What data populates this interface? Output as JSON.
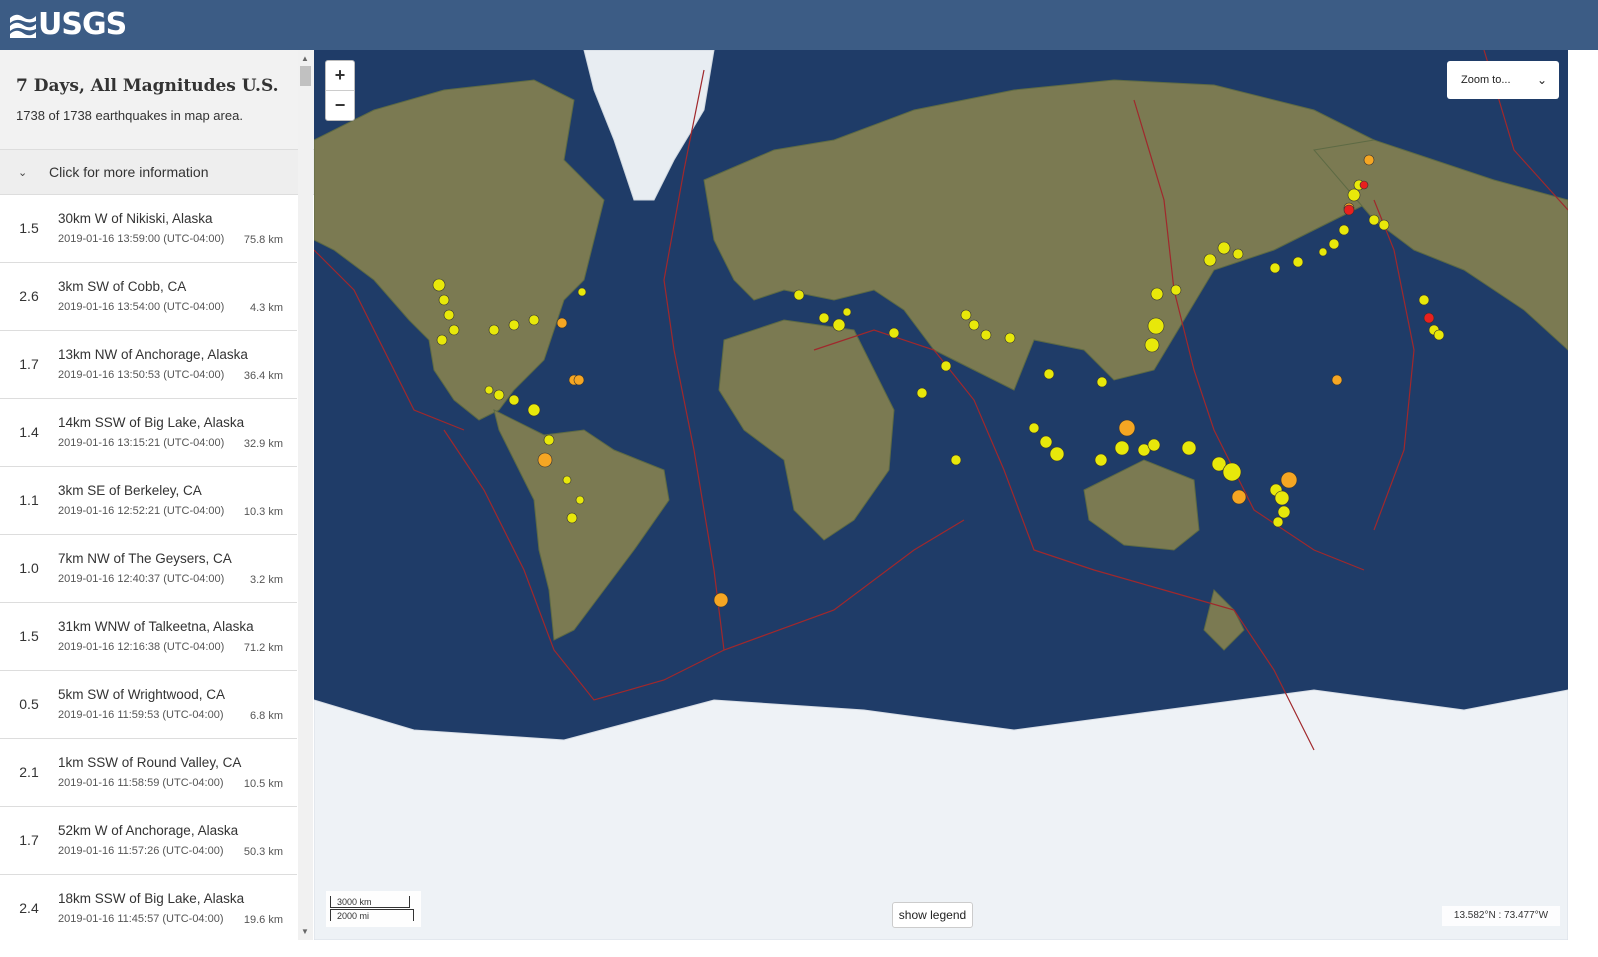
{
  "header": {
    "logo_text": "USGS"
  },
  "sidebar": {
    "title": "7 Days, All Magnitudes U.S.",
    "count": "1738 of 1738 earthquakes in map area.",
    "more_info": "Click for more information",
    "earthquakes": [
      {
        "mag": "1.5",
        "place": "30km W of Nikiski, Alaska",
        "time": "2019-01-16 13:59:00 (UTC-04:00)",
        "depth": "75.8 km"
      },
      {
        "mag": "2.6",
        "place": "3km SW of Cobb, CA",
        "time": "2019-01-16 13:54:00 (UTC-04:00)",
        "depth": "4.3 km"
      },
      {
        "mag": "1.7",
        "place": "13km NW of Anchorage, Alaska",
        "time": "2019-01-16 13:50:53 (UTC-04:00)",
        "depth": "36.4 km"
      },
      {
        "mag": "1.4",
        "place": "14km SSW of Big Lake, Alaska",
        "time": "2019-01-16 13:15:21 (UTC-04:00)",
        "depth": "32.9 km"
      },
      {
        "mag": "1.1",
        "place": "3km SE of Berkeley, CA",
        "time": "2019-01-16 12:52:21 (UTC-04:00)",
        "depth": "10.3 km"
      },
      {
        "mag": "1.0",
        "place": "7km NW of The Geysers, CA",
        "time": "2019-01-16 12:40:37 (UTC-04:00)",
        "depth": "3.2 km"
      },
      {
        "mag": "1.5",
        "place": "31km WNW of Talkeetna, Alaska",
        "time": "2019-01-16 12:16:38 (UTC-04:00)",
        "depth": "71.2 km"
      },
      {
        "mag": "0.5",
        "place": "5km SW of Wrightwood, CA",
        "time": "2019-01-16 11:59:53 (UTC-04:00)",
        "depth": "6.8 km"
      },
      {
        "mag": "2.1",
        "place": "1km SSW of Round Valley, CA",
        "time": "2019-01-16 11:58:59 (UTC-04:00)",
        "depth": "10.5 km"
      },
      {
        "mag": "1.7",
        "place": "52km W of Anchorage, Alaska",
        "time": "2019-01-16 11:57:26 (UTC-04:00)",
        "depth": "50.3 km"
      },
      {
        "mag": "2.4",
        "place": "18km SSW of Big Lake, Alaska",
        "time": "2019-01-16 11:45:57 (UTC-04:00)",
        "depth": "19.6 km"
      }
    ]
  },
  "map": {
    "zoom_in": "+",
    "zoom_out": "−",
    "zoom_to": "Zoom to...",
    "scale_km": "3000 km",
    "scale_mi": "2000 mi",
    "legend_button": "show legend",
    "coordinates": "13.582°N : 73.477°W",
    "colors": {
      "ocean": "#1e3a66",
      "land": "#7a7a4e",
      "ice": "#eef2f6",
      "plate_boundary": "#a0282c",
      "quake_recent": "#e8e80a",
      "quake_day": "#f5a623",
      "quake_hour": "#e8201e"
    }
  }
}
